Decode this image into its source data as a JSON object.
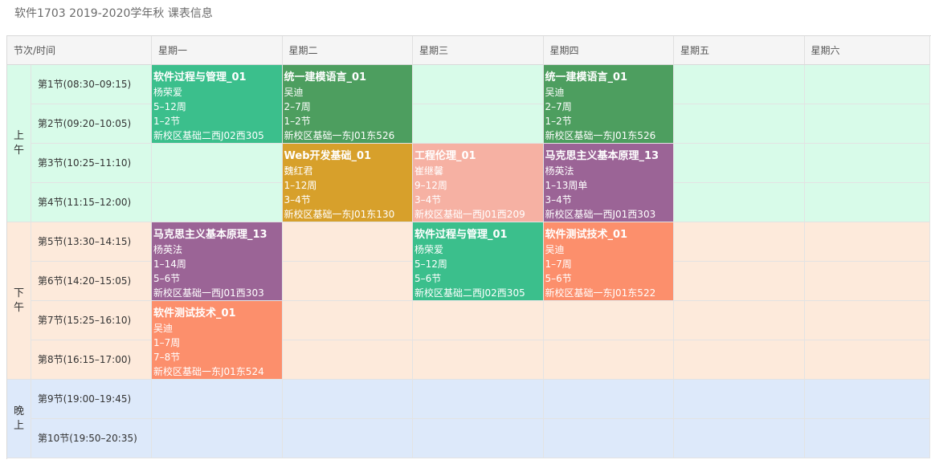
{
  "page_title": "软件1703 2019-2020学年秋 课表信息",
  "header": {
    "time_col": "节次/时间",
    "days": [
      "星期一",
      "星期二",
      "星期三",
      "星期四",
      "星期五",
      "星期六"
    ]
  },
  "periods": [
    {
      "label": "上午",
      "bg": "#d8fbe9"
    },
    {
      "label": "下午",
      "bg": "#fdeadb"
    },
    {
      "label": "晚上",
      "bg": "#dde9fa"
    }
  ],
  "slots": [
    "第1节(08:30–09:15)",
    "第2节(09:20–10:05)",
    "第3节(10:25–11:10)",
    "第4节(11:15–12:00)",
    "第5节(13:30–14:15)",
    "第6节(14:20–15:05)",
    "第7节(15:25–16:10)",
    "第8节(16:15–17:00)",
    "第9节(19:00–19:45)",
    "第10节(19:50–20:35)"
  ],
  "courses": [
    {
      "day": 0,
      "start": 0,
      "span": 2,
      "color": "#3bbf8c",
      "name": "软件过程与管理_01",
      "teacher": "杨荣爱",
      "weeks": "5–12周",
      "sessions": "1–2节",
      "room": "新校区基础二西J02西305"
    },
    {
      "day": 1,
      "start": 0,
      "span": 2,
      "color": "#4d9e5f",
      "name": "统一建模语言_01",
      "teacher": "吴迪",
      "weeks": "2–7周",
      "sessions": "1–2节",
      "room": "新校区基础一东J01东526"
    },
    {
      "day": 3,
      "start": 0,
      "span": 2,
      "color": "#4d9e5f",
      "name": "统一建模语言_01",
      "teacher": "吴迪",
      "weeks": "2–7周",
      "sessions": "1–2节",
      "room": "新校区基础一东J01东526"
    },
    {
      "day": 1,
      "start": 2,
      "span": 2,
      "color": "#d7a02b",
      "name": "Web开发基础_01",
      "teacher": "魏红君",
      "weeks": "1–12周",
      "sessions": "3–4节",
      "room": "新校区基础一东J01东130"
    },
    {
      "day": 2,
      "start": 2,
      "span": 2,
      "color": "#f6b1a3",
      "name": "工程伦理_01",
      "teacher": "崔继馨",
      "weeks": "9–12周",
      "sessions": "3–4节",
      "room": "新校区基础一西J01西209"
    },
    {
      "day": 3,
      "start": 2,
      "span": 2,
      "color": "#9b6496",
      "name": "马克思主义基本原理_13",
      "teacher": "杨英法",
      "weeks": "1–13周单",
      "sessions": "3–4节",
      "room": "新校区基础一西J01西303"
    },
    {
      "day": 0,
      "start": 4,
      "span": 2,
      "color": "#9b6496",
      "name": "马克思主义基本原理_13",
      "teacher": "杨英法",
      "weeks": "1–14周",
      "sessions": "5–6节",
      "room": "新校区基础一西J01西303"
    },
    {
      "day": 2,
      "start": 4,
      "span": 2,
      "color": "#3bbf8c",
      "name": "软件过程与管理_01",
      "teacher": "杨荣爱",
      "weeks": "5–12周",
      "sessions": "5–6节",
      "room": "新校区基础二西J02西305"
    },
    {
      "day": 3,
      "start": 4,
      "span": 2,
      "color": "#fc8f6c",
      "name": "软件测试技术_01",
      "teacher": "吴迪",
      "weeks": "1–7周",
      "sessions": "5–6节",
      "room": "新校区基础一东J01东522"
    },
    {
      "day": 0,
      "start": 6,
      "span": 2,
      "color": "#fc8f6c",
      "name": "软件测试技术_01",
      "teacher": "吴迪",
      "weeks": "1–7周",
      "sessions": "7–8节",
      "room": "新校区基础一东J01东524"
    }
  ]
}
